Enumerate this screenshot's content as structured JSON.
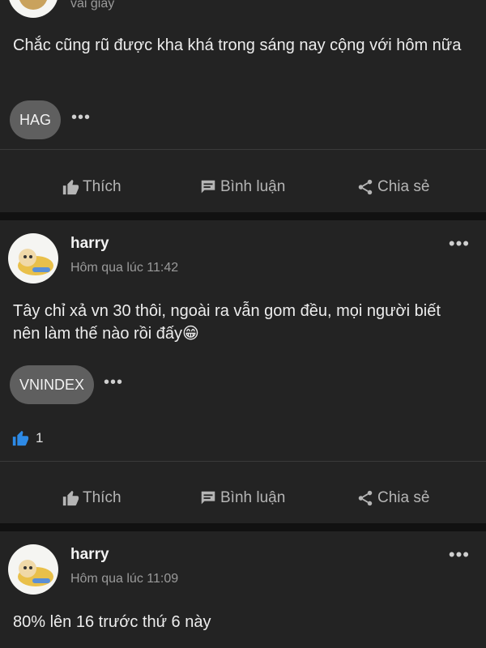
{
  "post1": {
    "time": "vài giây",
    "content": "Chắc cũng rũ được kha khá trong sáng nay cộng với hôm nữa",
    "tag": "HAG",
    "tag_more": "•••"
  },
  "post2": {
    "author": "harry",
    "time": "Hôm qua lúc 11:42",
    "content": "Tây chỉ xả vn 30 thôi, ngoài ra vẫn gom đều, mọi người biết nên làm thế nào rồi đấy",
    "emoji": "😁",
    "tag": "VNINDEX",
    "tag_more": "•••",
    "like_count": "1"
  },
  "post3": {
    "author": "harry",
    "time": "Hôm qua lúc 11:09",
    "content": "80% lên 16 trước thứ 6 này"
  },
  "actions": {
    "like": "Thích",
    "comment": "Bình luận",
    "share": "Chia sẻ"
  },
  "more_menu": "•••",
  "icons": {
    "like": "thumbs-up-icon",
    "comment": "comment-bubble-icon",
    "share": "share-icon",
    "reaction": "blue-thumbs-up-icon"
  },
  "colors": {
    "background": "#121212",
    "card": "#232323",
    "tag": "#5f5f5f",
    "reaction": "#2d8ae6"
  }
}
